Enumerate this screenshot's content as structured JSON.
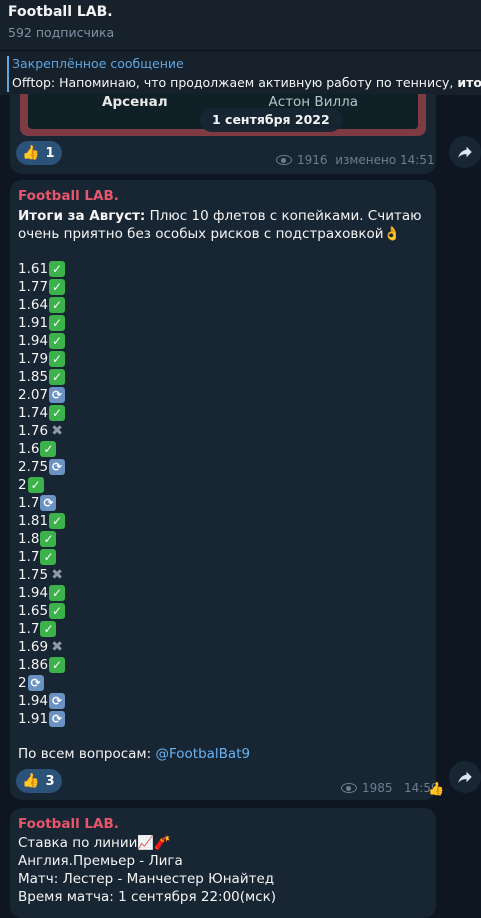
{
  "channel": {
    "title": "Football LAB.",
    "subscribers": "592 подписчика"
  },
  "pinned": {
    "title": "Закреплённое сообщение",
    "text_prefix": "Offtop:  Напоминаю, что продолжаем активную работу по теннису,",
    "text_bold": "итоги"
  },
  "prev_message": {
    "team_home": "Арсенал",
    "team_away": "Астон Вилла",
    "date_pill": "1 сентября 2022",
    "reaction_emoji": "👍",
    "reaction_count": "1",
    "views": "1916",
    "status": "изменено 14:51"
  },
  "message": {
    "author": "Football LAB.",
    "intro_bold": "Итоги за Август:",
    "intro_text": "  Плюс 10 флетов с копейками. Считаю очень приятно без особых рисков с подстраховкой👌",
    "odds": [
      {
        "value": "1.61",
        "result": "win"
      },
      {
        "value": "1.77",
        "result": "win"
      },
      {
        "value": "1.64",
        "result": "win"
      },
      {
        "value": "1.91",
        "result": "win"
      },
      {
        "value": "1.94",
        "result": "win"
      },
      {
        "value": "1.79",
        "result": "win"
      },
      {
        "value": "1.85",
        "result": "win"
      },
      {
        "value": "2.07",
        "result": "return"
      },
      {
        "value": "1.74",
        "result": "win"
      },
      {
        "value": "1.76",
        "result": "loss"
      },
      {
        "value": "1.6",
        "result": "win"
      },
      {
        "value": "2.75",
        "result": "return"
      },
      {
        "value": "2",
        "result": "win"
      },
      {
        "value": "1.7",
        "result": "return"
      },
      {
        "value": "1.81",
        "result": "win"
      },
      {
        "value": "1.8",
        "result": "win"
      },
      {
        "value": "1.7",
        "result": "win"
      },
      {
        "value": "1.75",
        "result": "loss"
      },
      {
        "value": "1.94",
        "result": "win"
      },
      {
        "value": "1.65",
        "result": "win"
      },
      {
        "value": "1.7",
        "result": "win"
      },
      {
        "value": "1.69",
        "result": "loss"
      },
      {
        "value": "1.86",
        "result": "win"
      },
      {
        "value": "2",
        "result": "return"
      },
      {
        "value": "1.94",
        "result": "return"
      },
      {
        "value": "1.91",
        "result": "return"
      }
    ],
    "contact_label": "По всем вопросам:",
    "contact_link": "@FootbalBat9",
    "reaction_emoji": "👍",
    "reaction_count": "3",
    "views": "1985",
    "time": "14:59"
  },
  "next_message": {
    "author": "Football LAB.",
    "line1": "Ставка по линии📈🧨",
    "line2": "Англия.Премьер - Лига",
    "line3": "Матч: Лестер - Манчестер Юнайтед",
    "line4": "Время матча: 1 сентября 22:00(мск)"
  },
  "colors": {
    "background": "#0e1621",
    "bubble": "#182533",
    "accent": "#5fa6e0",
    "author": "#e7566b",
    "win": "#3bb34a",
    "return": "#6a93c4"
  },
  "icons": {
    "share": "share-arrow-icon",
    "views": "eye-icon",
    "win": "check-mark-icon",
    "return": "refresh-icon",
    "loss": "cross-mark-icon"
  }
}
